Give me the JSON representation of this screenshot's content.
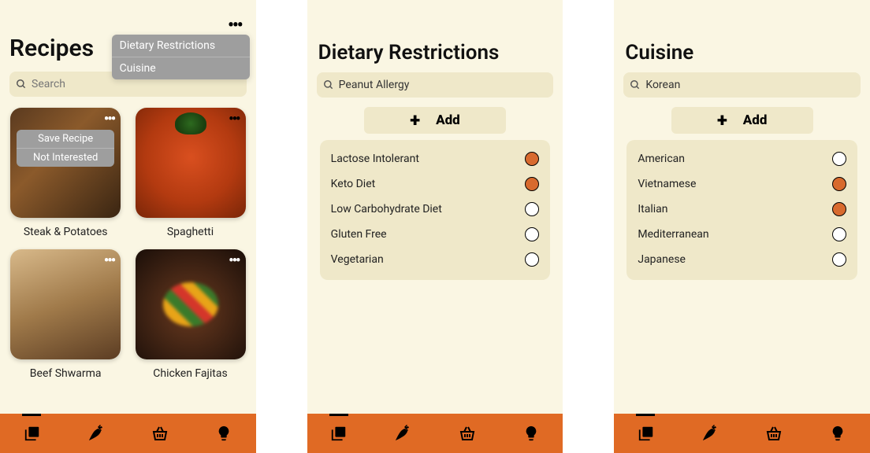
{
  "colors": {
    "bg": "#faf6e3",
    "accent": "#e06a24",
    "radio_on": "#d86a2e",
    "field": "#efe8c9"
  },
  "screen1": {
    "title": "Recipes",
    "search_placeholder": "Search",
    "menu": {
      "item1": "Dietary Restrictions",
      "item2": "Cuisine"
    },
    "card_menu": {
      "item1": "Save Recipe",
      "item2": "Not Interested"
    },
    "recipes": [
      {
        "name": "Steak & Potatoes"
      },
      {
        "name": "Spaghetti"
      },
      {
        "name": "Beef Shwarma"
      },
      {
        "name": "Chicken Fajitas"
      }
    ]
  },
  "screen2": {
    "title": "Dietary Restrictions",
    "search_value": "Peanut Allergy",
    "add_label": "Add",
    "options": [
      {
        "label": "Lactose Intolerant",
        "selected": true
      },
      {
        "label": "Keto Diet",
        "selected": true
      },
      {
        "label": "Low Carbohydrate Diet",
        "selected": false
      },
      {
        "label": "Gluten Free",
        "selected": false
      },
      {
        "label": "Vegetarian",
        "selected": false
      }
    ]
  },
  "screen3": {
    "title": "Cuisine",
    "search_value": "Korean",
    "add_label": "Add",
    "options": [
      {
        "label": "American",
        "selected": false
      },
      {
        "label": "Vietnamese",
        "selected": true
      },
      {
        "label": "Italian",
        "selected": true
      },
      {
        "label": "Mediterranean",
        "selected": false
      },
      {
        "label": "Japanese",
        "selected": false
      }
    ]
  },
  "tabbar_icons": [
    "library-icon",
    "carrot-icon",
    "basket-icon",
    "lightbulb-icon"
  ]
}
